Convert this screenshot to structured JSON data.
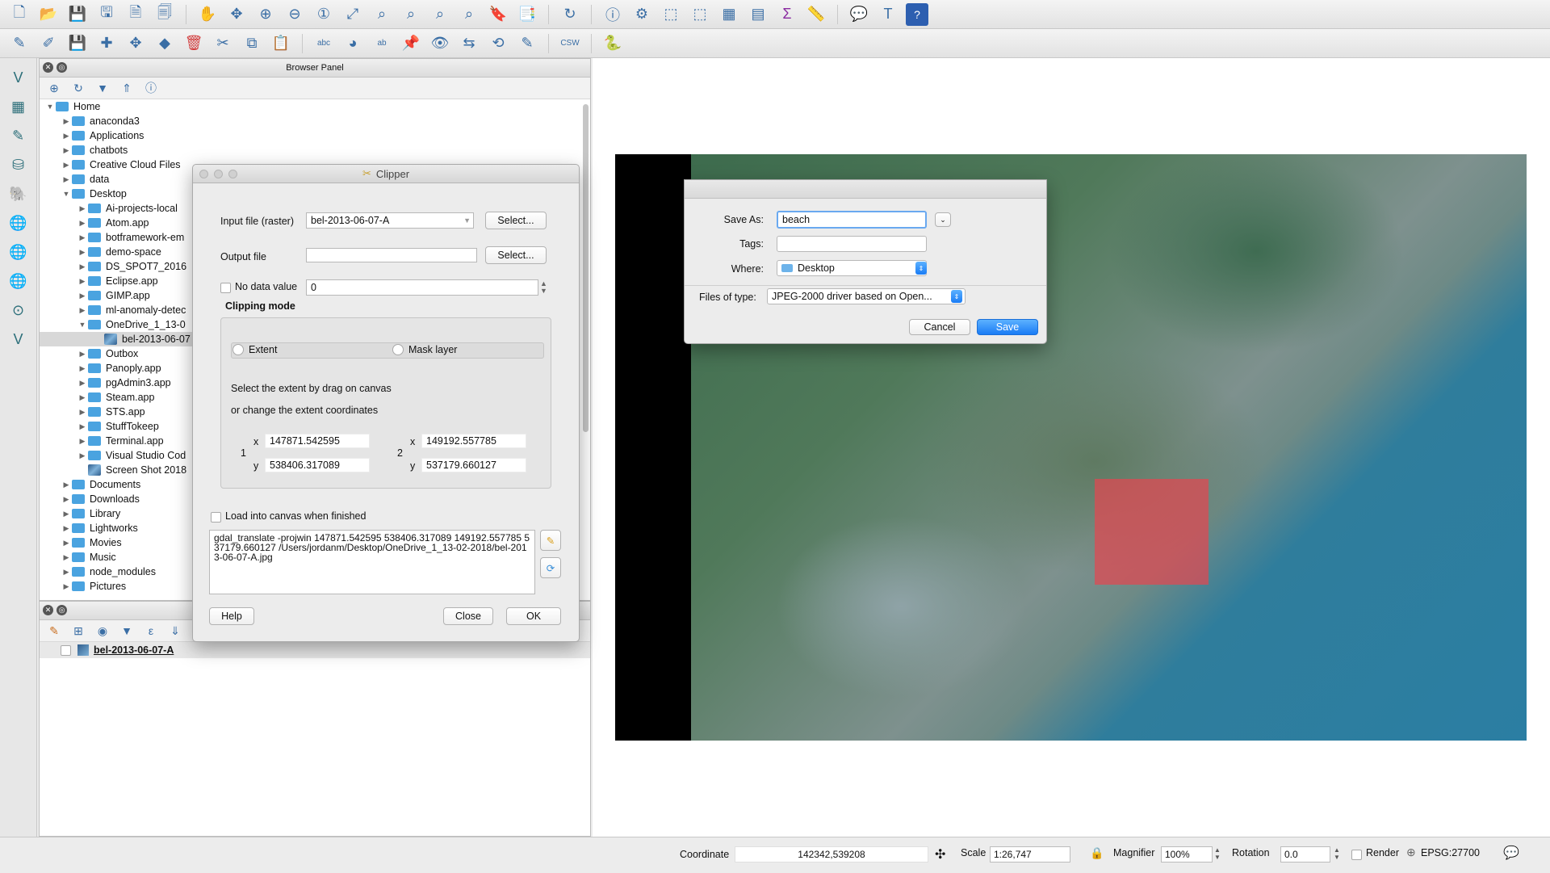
{
  "browser_panel": {
    "title": "Browser Panel",
    "tree": [
      {
        "label": "Home",
        "level": 0,
        "expanded": true
      },
      {
        "label": "anaconda3",
        "level": 1
      },
      {
        "label": "Applications",
        "level": 1
      },
      {
        "label": "chatbots",
        "level": 1
      },
      {
        "label": "Creative Cloud Files",
        "level": 1
      },
      {
        "label": "data",
        "level": 1
      },
      {
        "label": "Desktop",
        "level": 1,
        "expanded": true
      },
      {
        "label": "Ai-projects-local",
        "level": 2
      },
      {
        "label": "Atom.app",
        "level": 2
      },
      {
        "label": "botframework-em",
        "level": 2
      },
      {
        "label": "demo-space",
        "level": 2
      },
      {
        "label": "DS_SPOT7_2016",
        "level": 2
      },
      {
        "label": "Eclipse.app",
        "level": 2
      },
      {
        "label": "GIMP.app",
        "level": 2
      },
      {
        "label": "ml-anomaly-detec",
        "level": 2
      },
      {
        "label": "OneDrive_1_13-0",
        "level": 2,
        "expanded": true
      },
      {
        "label": "bel-2013-06-07",
        "level": 3,
        "selected": true,
        "raster": true
      },
      {
        "label": "Outbox",
        "level": 2
      },
      {
        "label": "Panoply.app",
        "level": 2
      },
      {
        "label": "pgAdmin3.app",
        "level": 2
      },
      {
        "label": "Steam.app",
        "level": 2
      },
      {
        "label": "STS.app",
        "level": 2
      },
      {
        "label": "StuffTokeep",
        "level": 2
      },
      {
        "label": "Terminal.app",
        "level": 2
      },
      {
        "label": "Visual Studio Cod",
        "level": 2
      },
      {
        "label": "Screen Shot 2018",
        "level": 2,
        "raster": true,
        "no_arrow": true
      },
      {
        "label": "Documents",
        "level": 1
      },
      {
        "label": "Downloads",
        "level": 1
      },
      {
        "label": "Library",
        "level": 1
      },
      {
        "label": "Lightworks",
        "level": 1
      },
      {
        "label": "Movies",
        "level": 1
      },
      {
        "label": "Music",
        "level": 1
      },
      {
        "label": "node_modules",
        "level": 1
      },
      {
        "label": "Pictures",
        "level": 1
      }
    ]
  },
  "layers_panel": {
    "layer_name": "bel-2013-06-07-A"
  },
  "clipper": {
    "title": "Clipper",
    "input_label": "Input file (raster)",
    "input_value": "bel-2013-06-07-A",
    "select_label": "Select...",
    "output_label": "Output file",
    "output_value": "",
    "nodata_label": "No data value",
    "nodata_value": "0",
    "clipping_mode_label": "Clipping mode",
    "extent_label": "Extent",
    "mask_label": "Mask layer",
    "hint1": "Select the extent by drag on canvas",
    "hint2": "or change the extent coordinates",
    "p1_label": "1",
    "p2_label": "2",
    "x_label": "x",
    "y_label": "y",
    "x1": "147871.542595",
    "y1": "538406.317089",
    "x2": "149192.557785",
    "y2": "537179.660127",
    "load_label": "Load into canvas when finished",
    "command": "gdal_translate -projwin 147871.542595 538406.317089 149192.557785 537179.660127 /Users/jordanm/Desktop/OneDrive_1_13-02-2018/bel-2013-06-07-A.jpg",
    "help_label": "Help",
    "close_label": "Close",
    "ok_label": "OK"
  },
  "save_dialog": {
    "save_as_label": "Save As:",
    "save_as_value": "beach",
    "tags_label": "Tags:",
    "where_label": "Where:",
    "where_value": "Desktop",
    "files_type_label": "Files of type:",
    "files_type_value": "JPEG-2000 driver based on Open...",
    "cancel_label": "Cancel",
    "save_label": "Save"
  },
  "statusbar": {
    "coordinate_label": "Coordinate",
    "coordinate_value": "142342,539208",
    "scale_label": "Scale",
    "scale_value": "1:26,747",
    "magnifier_label": "Magnifier",
    "magnifier_value": "100%",
    "rotation_label": "Rotation",
    "rotation_value": "0.0",
    "render_label": "Render",
    "crs_label": "EPSG:27700"
  },
  "colors": {
    "accent": "#1a7cf5",
    "folder": "#4aa3e0",
    "clip_extent": "#e64650"
  },
  "toolbar1_icons": [
    "new-project-icon",
    "open-project-icon",
    "save-project-icon",
    "save-as-icon",
    "new-print-layout-icon",
    "layout-manager-icon",
    "pan-icon",
    "pan-to-selection-icon",
    "zoom-in-icon",
    "zoom-out-icon",
    "zoom-native-icon",
    "zoom-full-icon",
    "zoom-selection-icon",
    "zoom-layer-icon",
    "zoom-last-icon",
    "zoom-next-icon",
    "new-bookmark-icon",
    "show-bookmarks-icon",
    "refresh-icon",
    "identify-icon",
    "action-icon",
    "select-icon",
    "deselect-icon",
    "attribute-table-icon",
    "field-calculator-icon",
    "statistics-icon",
    "measure-icon",
    "map-tips-icon",
    "text-annotation-icon",
    "help-icon"
  ],
  "toolbar2_icons": [
    "digitize-icon",
    "toggle-edit-icon",
    "save-edits-icon",
    "add-feature-icon",
    "move-feature-icon",
    "node-tool-icon",
    "delete-icon",
    "cut-icon",
    "copy-icon",
    "paste-icon",
    "label-icon",
    "diagram-icon",
    "label-highlight-icon",
    "pin-label-icon",
    "show-label-icon",
    "move-label-icon",
    "rotate-label-icon",
    "change-label-icon",
    "csw-icon",
    "python-icon"
  ],
  "vtool_icons": [
    "add-vector-icon",
    "add-raster-icon",
    "add-delimited-icon",
    "add-spatialite-icon",
    "add-postgis-icon",
    "add-wms-icon",
    "add-wcs-icon",
    "add-wfs-icon",
    "add-oracle-icon",
    "new-layer-icon"
  ]
}
